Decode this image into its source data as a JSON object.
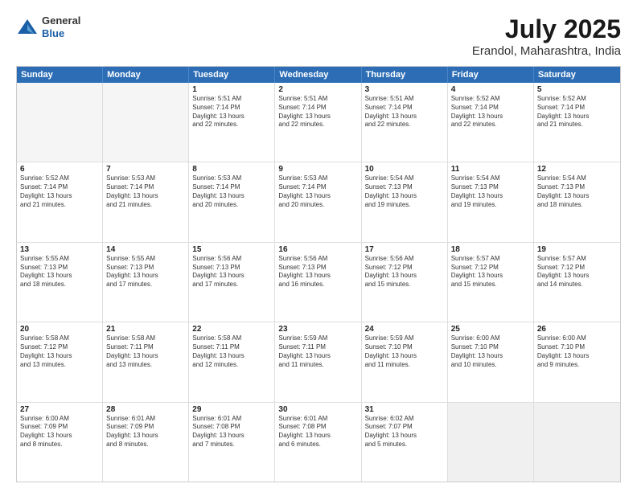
{
  "logo": {
    "general": "General",
    "blue": "Blue"
  },
  "title": "July 2025",
  "subtitle": "Erandol, Maharashtra, India",
  "headers": [
    "Sunday",
    "Monday",
    "Tuesday",
    "Wednesday",
    "Thursday",
    "Friday",
    "Saturday"
  ],
  "rows": [
    [
      {
        "day": "",
        "lines": [],
        "empty": true
      },
      {
        "day": "",
        "lines": [],
        "empty": true
      },
      {
        "day": "1",
        "lines": [
          "Sunrise: 5:51 AM",
          "Sunset: 7:14 PM",
          "Daylight: 13 hours",
          "and 22 minutes."
        ]
      },
      {
        "day": "2",
        "lines": [
          "Sunrise: 5:51 AM",
          "Sunset: 7:14 PM",
          "Daylight: 13 hours",
          "and 22 minutes."
        ]
      },
      {
        "day": "3",
        "lines": [
          "Sunrise: 5:51 AM",
          "Sunset: 7:14 PM",
          "Daylight: 13 hours",
          "and 22 minutes."
        ]
      },
      {
        "day": "4",
        "lines": [
          "Sunrise: 5:52 AM",
          "Sunset: 7:14 PM",
          "Daylight: 13 hours",
          "and 22 minutes."
        ]
      },
      {
        "day": "5",
        "lines": [
          "Sunrise: 5:52 AM",
          "Sunset: 7:14 PM",
          "Daylight: 13 hours",
          "and 21 minutes."
        ]
      }
    ],
    [
      {
        "day": "6",
        "lines": [
          "Sunrise: 5:52 AM",
          "Sunset: 7:14 PM",
          "Daylight: 13 hours",
          "and 21 minutes."
        ]
      },
      {
        "day": "7",
        "lines": [
          "Sunrise: 5:53 AM",
          "Sunset: 7:14 PM",
          "Daylight: 13 hours",
          "and 21 minutes."
        ]
      },
      {
        "day": "8",
        "lines": [
          "Sunrise: 5:53 AM",
          "Sunset: 7:14 PM",
          "Daylight: 13 hours",
          "and 20 minutes."
        ]
      },
      {
        "day": "9",
        "lines": [
          "Sunrise: 5:53 AM",
          "Sunset: 7:14 PM",
          "Daylight: 13 hours",
          "and 20 minutes."
        ]
      },
      {
        "day": "10",
        "lines": [
          "Sunrise: 5:54 AM",
          "Sunset: 7:13 PM",
          "Daylight: 13 hours",
          "and 19 minutes."
        ]
      },
      {
        "day": "11",
        "lines": [
          "Sunrise: 5:54 AM",
          "Sunset: 7:13 PM",
          "Daylight: 13 hours",
          "and 19 minutes."
        ]
      },
      {
        "day": "12",
        "lines": [
          "Sunrise: 5:54 AM",
          "Sunset: 7:13 PM",
          "Daylight: 13 hours",
          "and 18 minutes."
        ]
      }
    ],
    [
      {
        "day": "13",
        "lines": [
          "Sunrise: 5:55 AM",
          "Sunset: 7:13 PM",
          "Daylight: 13 hours",
          "and 18 minutes."
        ]
      },
      {
        "day": "14",
        "lines": [
          "Sunrise: 5:55 AM",
          "Sunset: 7:13 PM",
          "Daylight: 13 hours",
          "and 17 minutes."
        ]
      },
      {
        "day": "15",
        "lines": [
          "Sunrise: 5:56 AM",
          "Sunset: 7:13 PM",
          "Daylight: 13 hours",
          "and 17 minutes."
        ]
      },
      {
        "day": "16",
        "lines": [
          "Sunrise: 5:56 AM",
          "Sunset: 7:13 PM",
          "Daylight: 13 hours",
          "and 16 minutes."
        ]
      },
      {
        "day": "17",
        "lines": [
          "Sunrise: 5:56 AM",
          "Sunset: 7:12 PM",
          "Daylight: 13 hours",
          "and 15 minutes."
        ]
      },
      {
        "day": "18",
        "lines": [
          "Sunrise: 5:57 AM",
          "Sunset: 7:12 PM",
          "Daylight: 13 hours",
          "and 15 minutes."
        ]
      },
      {
        "day": "19",
        "lines": [
          "Sunrise: 5:57 AM",
          "Sunset: 7:12 PM",
          "Daylight: 13 hours",
          "and 14 minutes."
        ]
      }
    ],
    [
      {
        "day": "20",
        "lines": [
          "Sunrise: 5:58 AM",
          "Sunset: 7:12 PM",
          "Daylight: 13 hours",
          "and 13 minutes."
        ]
      },
      {
        "day": "21",
        "lines": [
          "Sunrise: 5:58 AM",
          "Sunset: 7:11 PM",
          "Daylight: 13 hours",
          "and 13 minutes."
        ]
      },
      {
        "day": "22",
        "lines": [
          "Sunrise: 5:58 AM",
          "Sunset: 7:11 PM",
          "Daylight: 13 hours",
          "and 12 minutes."
        ]
      },
      {
        "day": "23",
        "lines": [
          "Sunrise: 5:59 AM",
          "Sunset: 7:11 PM",
          "Daylight: 13 hours",
          "and 11 minutes."
        ]
      },
      {
        "day": "24",
        "lines": [
          "Sunrise: 5:59 AM",
          "Sunset: 7:10 PM",
          "Daylight: 13 hours",
          "and 11 minutes."
        ]
      },
      {
        "day": "25",
        "lines": [
          "Sunrise: 6:00 AM",
          "Sunset: 7:10 PM",
          "Daylight: 13 hours",
          "and 10 minutes."
        ]
      },
      {
        "day": "26",
        "lines": [
          "Sunrise: 6:00 AM",
          "Sunset: 7:10 PM",
          "Daylight: 13 hours",
          "and 9 minutes."
        ]
      }
    ],
    [
      {
        "day": "27",
        "lines": [
          "Sunrise: 6:00 AM",
          "Sunset: 7:09 PM",
          "Daylight: 13 hours",
          "and 8 minutes."
        ]
      },
      {
        "day": "28",
        "lines": [
          "Sunrise: 6:01 AM",
          "Sunset: 7:09 PM",
          "Daylight: 13 hours",
          "and 8 minutes."
        ]
      },
      {
        "day": "29",
        "lines": [
          "Sunrise: 6:01 AM",
          "Sunset: 7:08 PM",
          "Daylight: 13 hours",
          "and 7 minutes."
        ]
      },
      {
        "day": "30",
        "lines": [
          "Sunrise: 6:01 AM",
          "Sunset: 7:08 PM",
          "Daylight: 13 hours",
          "and 6 minutes."
        ]
      },
      {
        "day": "31",
        "lines": [
          "Sunrise: 6:02 AM",
          "Sunset: 7:07 PM",
          "Daylight: 13 hours",
          "and 5 minutes."
        ]
      },
      {
        "day": "",
        "lines": [],
        "empty": true,
        "shaded": true
      },
      {
        "day": "",
        "lines": [],
        "empty": true,
        "shaded": true
      }
    ]
  ]
}
